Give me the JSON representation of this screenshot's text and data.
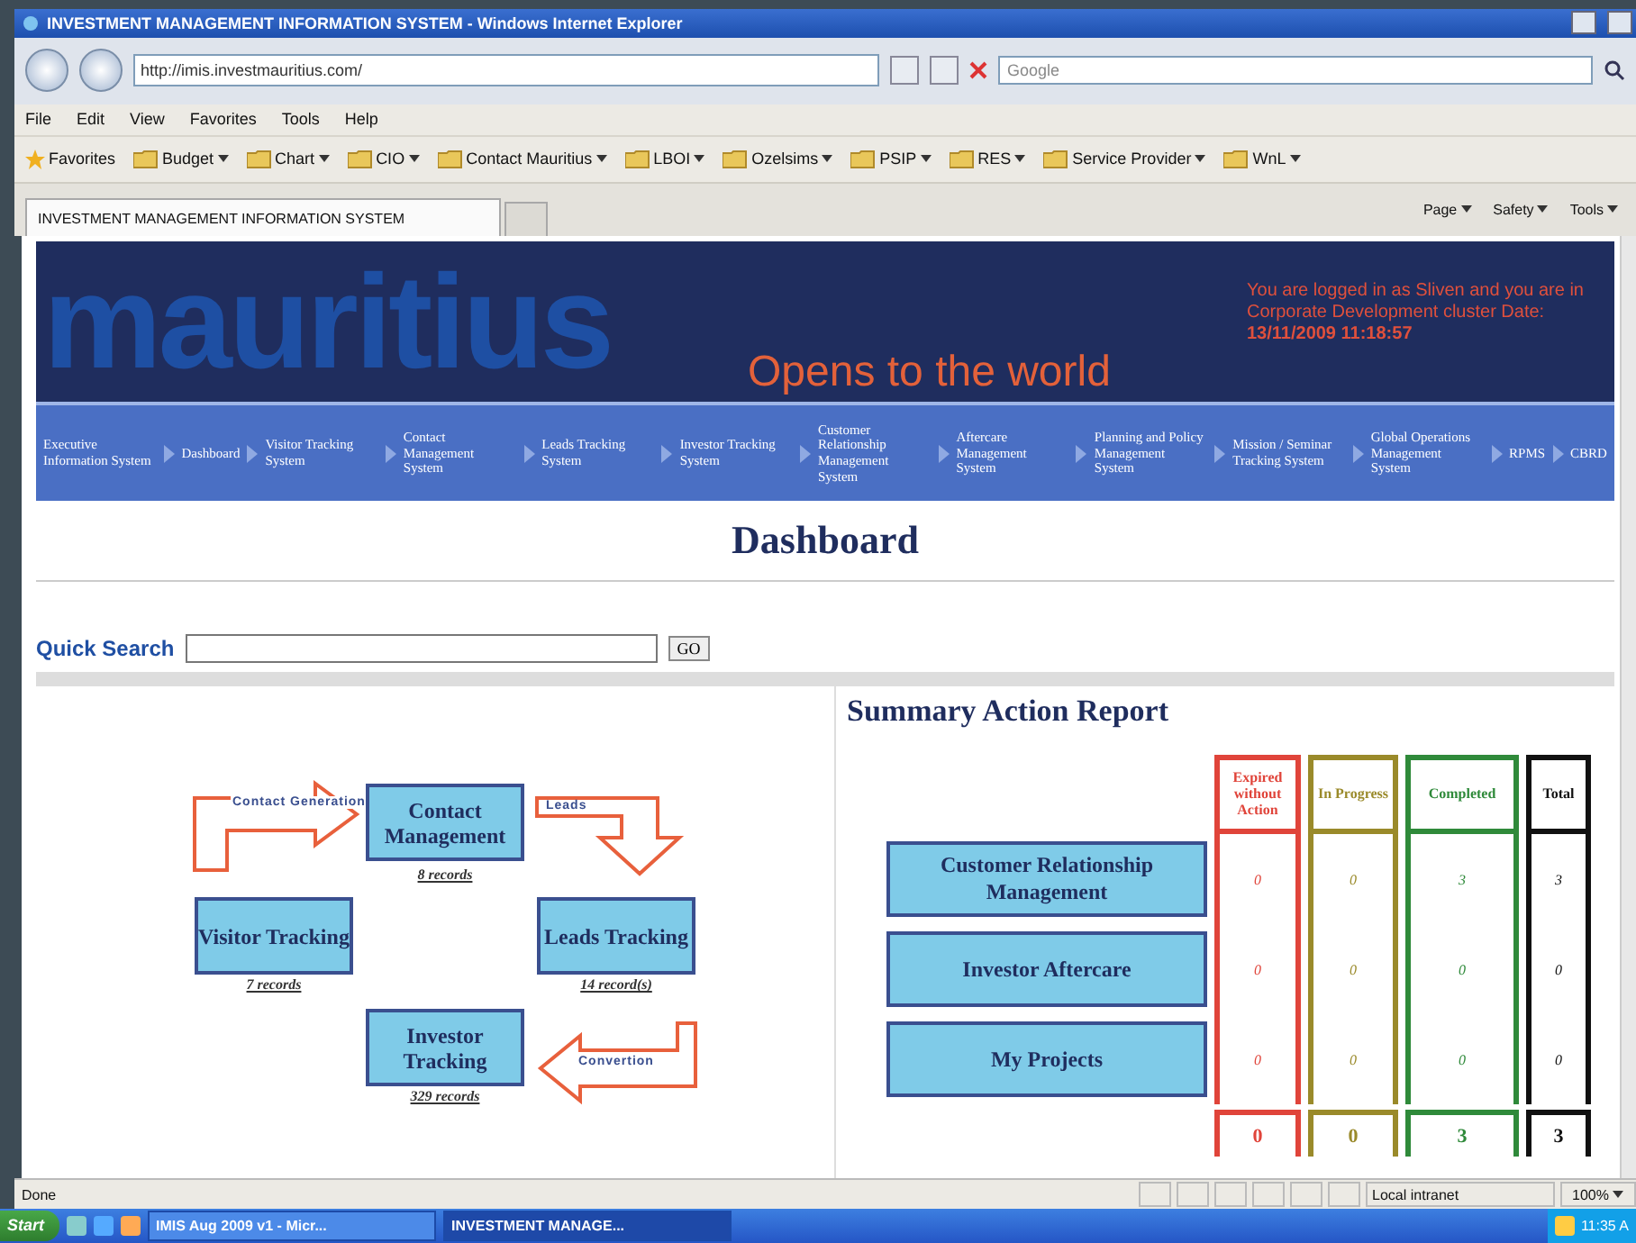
{
  "browser": {
    "title": "INVESTMENT MANAGEMENT INFORMATION SYSTEM - Windows Internet Explorer",
    "address": "http://imis.investmauritius.com/",
    "search": {
      "placeholder": "Google"
    },
    "menu": [
      "File",
      "Edit",
      "View",
      "Favorites",
      "Tools",
      "Help"
    ],
    "favorites": {
      "label": "Favorites",
      "folders": [
        "Budget",
        "Chart",
        "CIO",
        "Contact Mauritius",
        "LBOI",
        "Ozelsims",
        "PSIP",
        "RES",
        "Service Provider",
        "WnL"
      ]
    },
    "tabs": [
      {
        "label": "INVESTMENT MANAGEMENT INFORMATION SYSTEM",
        "selected": true
      }
    ],
    "commands": [
      "Page",
      "Safety",
      "Tools"
    ]
  },
  "banner": {
    "logo_text": "mauritius",
    "tagline": "Opens to the world",
    "login_text": "You are logged in as Sliven and you are in Corporate Development cluster Date: **13/11/2009 11:18:57**"
  },
  "nav": [
    "Executive Information System",
    "Dashboard",
    "Visitor Tracking System",
    "Contact Management System",
    "Leads Tracking System",
    "Investor Tracking System",
    "Customer Relationship Management System",
    "Aftercare Management System",
    "Planning and Policy Management System",
    "Mission / Seminar Tracking System",
    "Global Operations Management System",
    "RPMS",
    "CBRD"
  ],
  "page_title": "Dashboard",
  "quick_search": {
    "label": "Quick Search",
    "button": "GO"
  },
  "diagram": {
    "nodes": [
      {
        "label": "Contact Management",
        "records": "8 records"
      },
      {
        "label": "Visitor Tracking",
        "records": "7 records"
      },
      {
        "label": "Leads Tracking",
        "records": "14 record(s)"
      },
      {
        "label": "Investor Tracking",
        "records": "329 records"
      }
    ],
    "arrows": [
      {
        "label": "Contact Generation"
      },
      {
        "label": "Leads"
      },
      {
        "label": "Convertion"
      }
    ]
  },
  "summary": {
    "title": "Summary Action Report",
    "columns": [
      {
        "label": "Expired without Action",
        "color": "#e0443a"
      },
      {
        "label": "In Progress",
        "color": "#9a8a2a"
      },
      {
        "label": "Completed",
        "color": "#2f8a3a"
      },
      {
        "label": "Total",
        "color": "#111111"
      }
    ],
    "rows": [
      {
        "label": "Customer Relationship Management",
        "values": [
          "0",
          "0",
          "3",
          "3"
        ]
      },
      {
        "label": "Investor Aftercare",
        "values": [
          "0",
          "0",
          "0",
          "0"
        ]
      },
      {
        "label": "My Projects",
        "values": [
          "0",
          "0",
          "0",
          "0"
        ]
      }
    ],
    "totals": [
      "0",
      "0",
      "3",
      "3"
    ]
  },
  "status_bar": {
    "text": "Done",
    "zone": "Local intranet",
    "zoom": "100%"
  },
  "taskbar": {
    "start": "Start",
    "tasks": [
      {
        "label": "IMIS Aug 2009 v1 - Micr...",
        "selected": false
      },
      {
        "label": "INVESTMENT MANAGE...",
        "selected": true
      }
    ],
    "clock": "11:35 A"
  }
}
